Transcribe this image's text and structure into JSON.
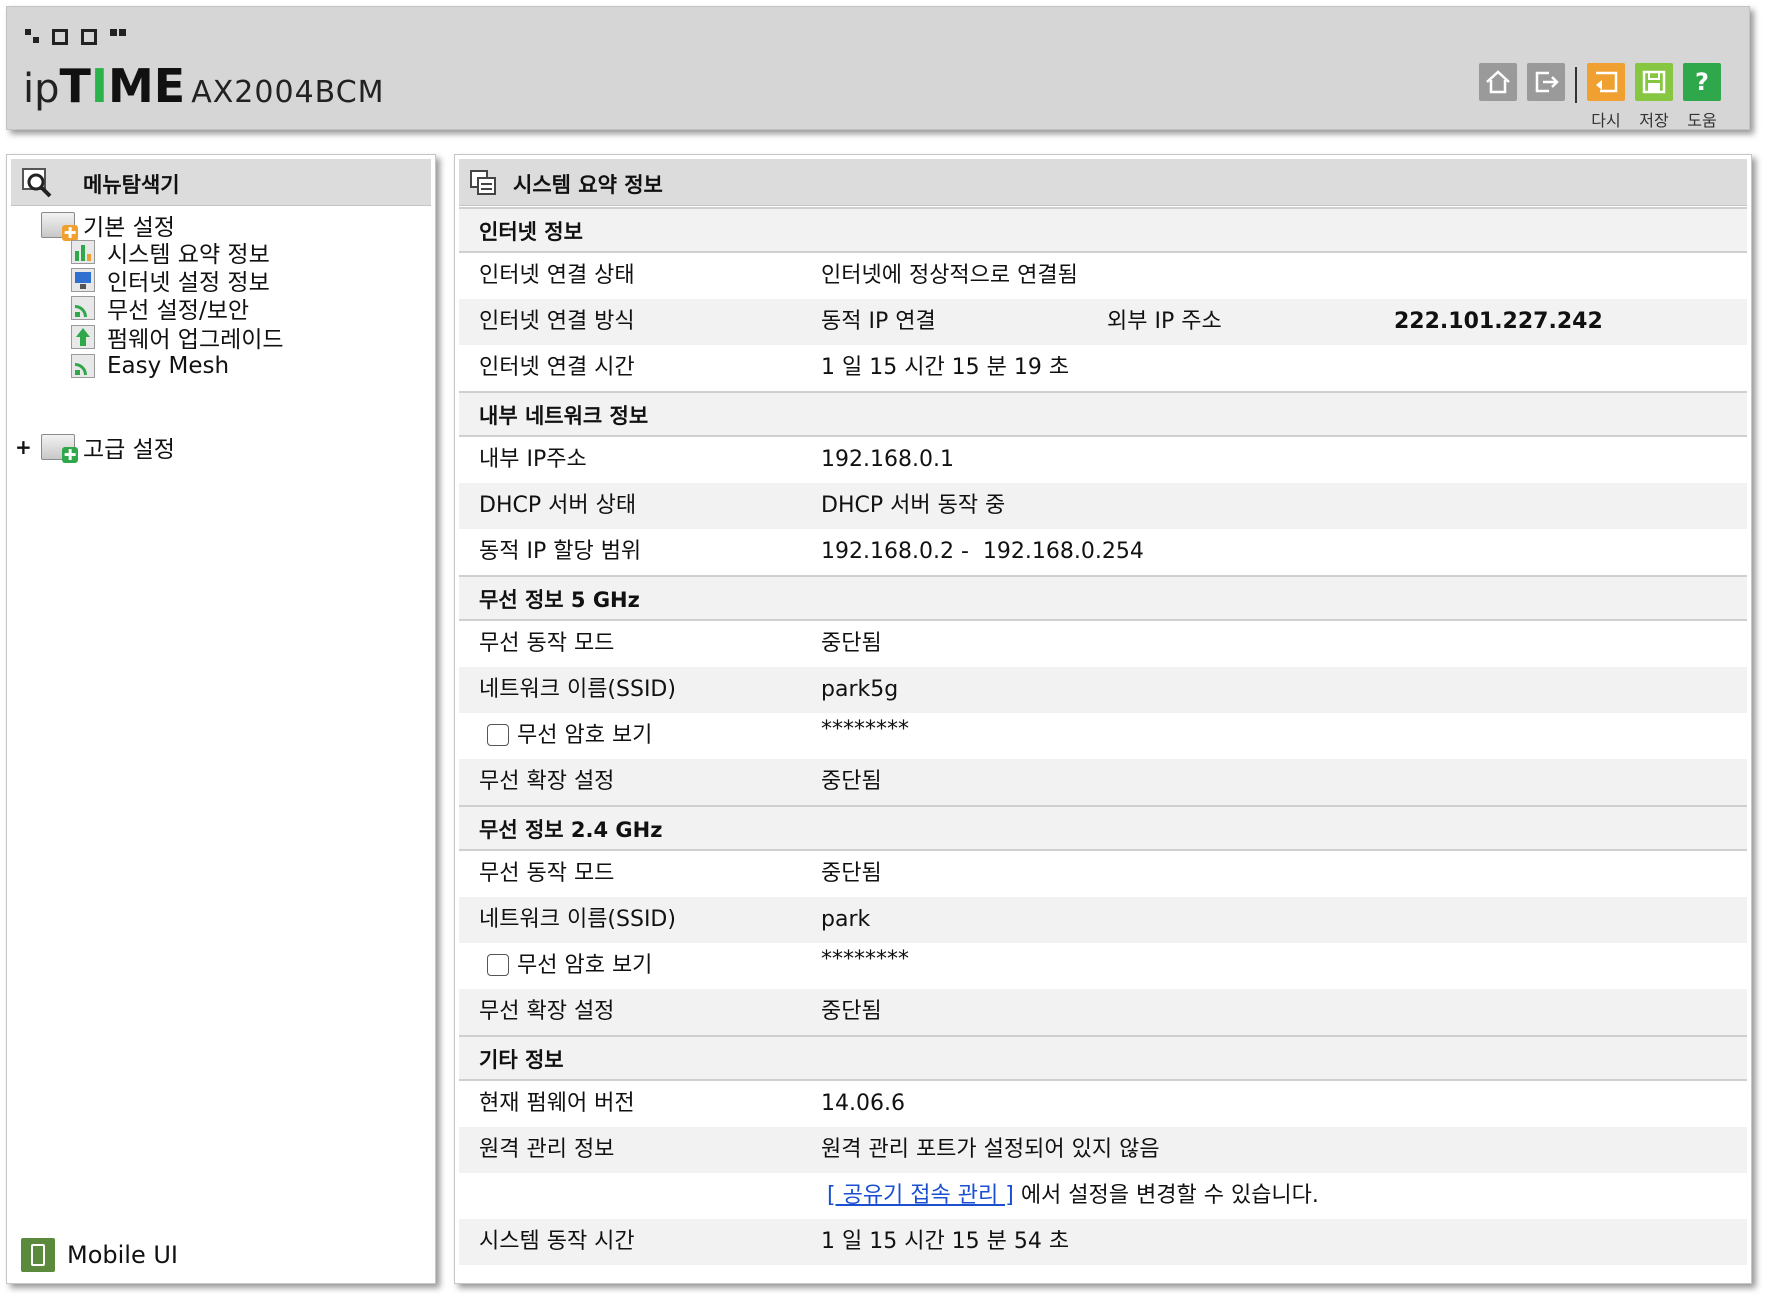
{
  "header": {
    "logo_ip": "ip",
    "logo_time_a": "T",
    "logo_time_b": "I",
    "logo_time_c": "ME",
    "model": "AX2004BCM",
    "toolbar": {
      "home_icon": "home-icon",
      "logout_icon": "logout-icon",
      "retry_label": "다시",
      "save_label": "저장",
      "help_label": "도움",
      "colors": {
        "retry": "#f0a030",
        "save": "#86c640",
        "help": "#2ea84a",
        "gray": "#9a9a9a"
      }
    }
  },
  "sidebar": {
    "title": "메뉴탐색기",
    "groups": [
      {
        "label": "기본 설정",
        "items": [
          {
            "label": "시스템 요약 정보"
          },
          {
            "label": "인터넷 설정 정보"
          },
          {
            "label": "무선 설정/보안"
          },
          {
            "label": "펌웨어 업그레이드"
          },
          {
            "label": "Easy Mesh"
          }
        ]
      },
      {
        "label": "고급 설정",
        "expander": "+"
      }
    ],
    "mobile_ui": "Mobile UI"
  },
  "main": {
    "title": "시스템 요약 정보",
    "internet": {
      "header": "인터넷 정보",
      "status_label": "인터넷 연결 상태",
      "status_value": "인터넷에 정상적으로 연결됨",
      "method_label": "인터넷 연결 방식",
      "method_value": "동적 IP 연결",
      "ext_ip_label": "외부 IP 주소",
      "ext_ip_value": "222.101.227.242",
      "time_label": "인터넷 연결 시간",
      "time_value": "1 일 15 시간 15 분 19 초"
    },
    "lan": {
      "header": "내부 네트워크 정보",
      "ip_label": "내부 IP주소",
      "ip_value": "192.168.0.1",
      "dhcp_label": "DHCP 서버 상태",
      "dhcp_value": "DHCP 서버 동작 중",
      "range_label": "동적 IP 할당 범위",
      "range_value": "192.168.0.2 -  192.168.0.254"
    },
    "wifi5": {
      "header": "무선 정보 5 GHz",
      "mode_label": "무선 동작 모드",
      "mode_value": "중단됨",
      "ssid_label": "네트워크 이름(SSID)",
      "ssid_value": "park5g",
      "pw_label": "무선 암호 보기",
      "pw_value": "********",
      "ext_label": "무선 확장 설정",
      "ext_value": "중단됨"
    },
    "wifi24": {
      "header": "무선 정보 2.4 GHz",
      "mode_label": "무선 동작 모드",
      "mode_value": "중단됨",
      "ssid_label": "네트워크 이름(SSID)",
      "ssid_value": "park",
      "pw_label": "무선 암호 보기",
      "pw_value": "********",
      "ext_label": "무선 확장 설정",
      "ext_value": "중단됨"
    },
    "other": {
      "header": "기타 정보",
      "fw_label": "현재 펌웨어 버전",
      "fw_value": "14.06.6",
      "remote_label": "원격 관리 정보",
      "remote_value": "원격 관리 포트가 설정되어 있지 않음",
      "remote_link": "[ 공유기 접속 관리 ]",
      "remote_hint": " 에서 설정을 변경할 수 있습니다.",
      "uptime_label": "시스템 동작 시간",
      "uptime_value": "1 일 15 시간 15 분 54 초"
    }
  }
}
